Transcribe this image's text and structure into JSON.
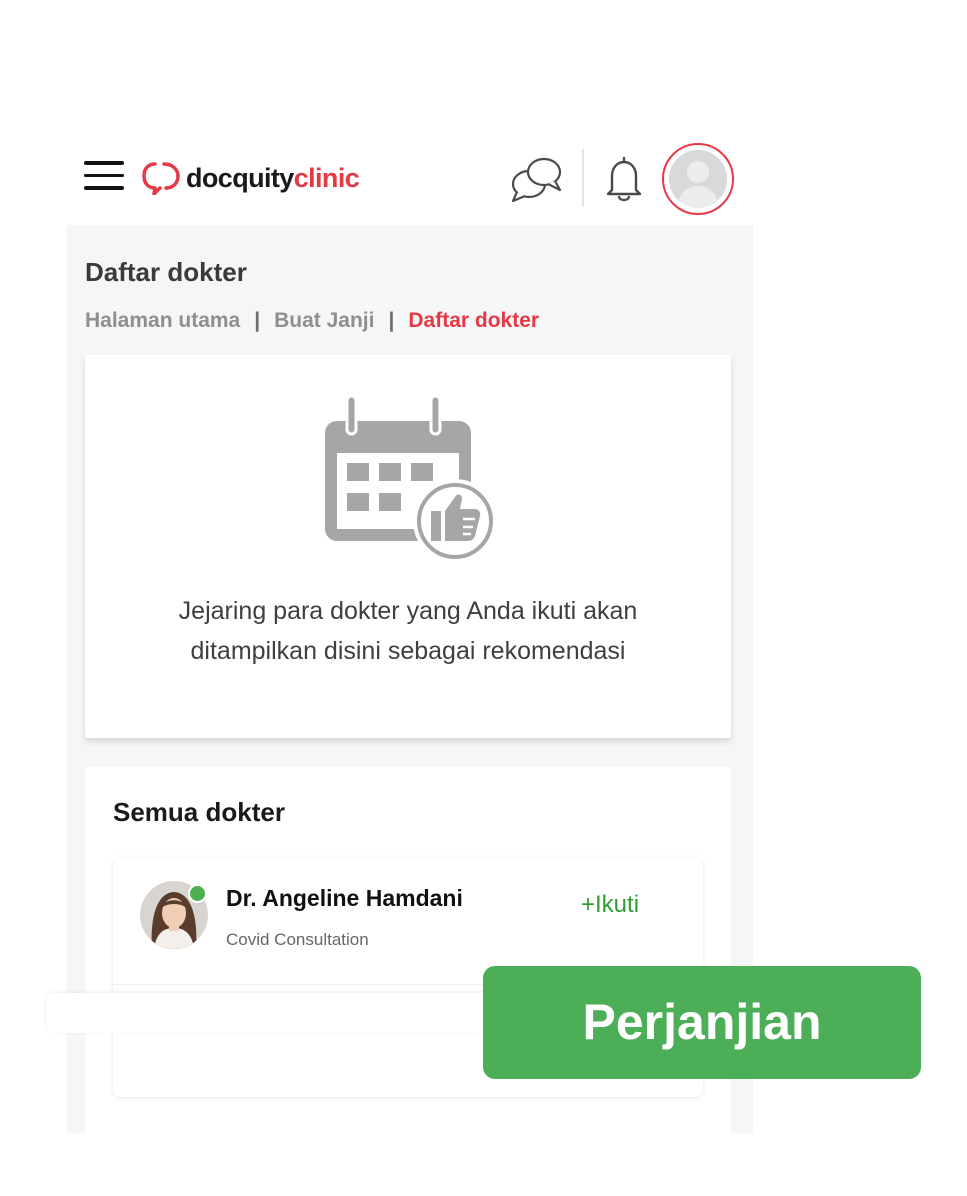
{
  "header": {
    "logo": {
      "part1": "docquity",
      "part2": "clinic",
      "brand_color": "#e63946"
    },
    "icons": [
      "menu-icon",
      "chat-icon",
      "bell-icon",
      "avatar-icon"
    ]
  },
  "page": {
    "title": "Daftar dokter",
    "breadcrumb": [
      {
        "label": "Halaman utama"
      },
      {
        "label": "Buat Janji"
      },
      {
        "label": "Daftar dokter",
        "active": true
      }
    ],
    "breadcrumb_separator": "|"
  },
  "empty_state": {
    "icon": "calendar-thumbs-up-icon",
    "message": "Jejaring para dokter yang Anda ikuti akan ditampilkan disini sebagai rekomendasi"
  },
  "all_doctors": {
    "title": "Semua dokter",
    "doctors": [
      {
        "name": "Dr. Angeline Hamdani",
        "specialty": "Covid Consultation",
        "online": true,
        "follow_label": "+Ikuti"
      }
    ]
  },
  "cta": {
    "label": "Perjanjian",
    "color": "#4caf58"
  }
}
